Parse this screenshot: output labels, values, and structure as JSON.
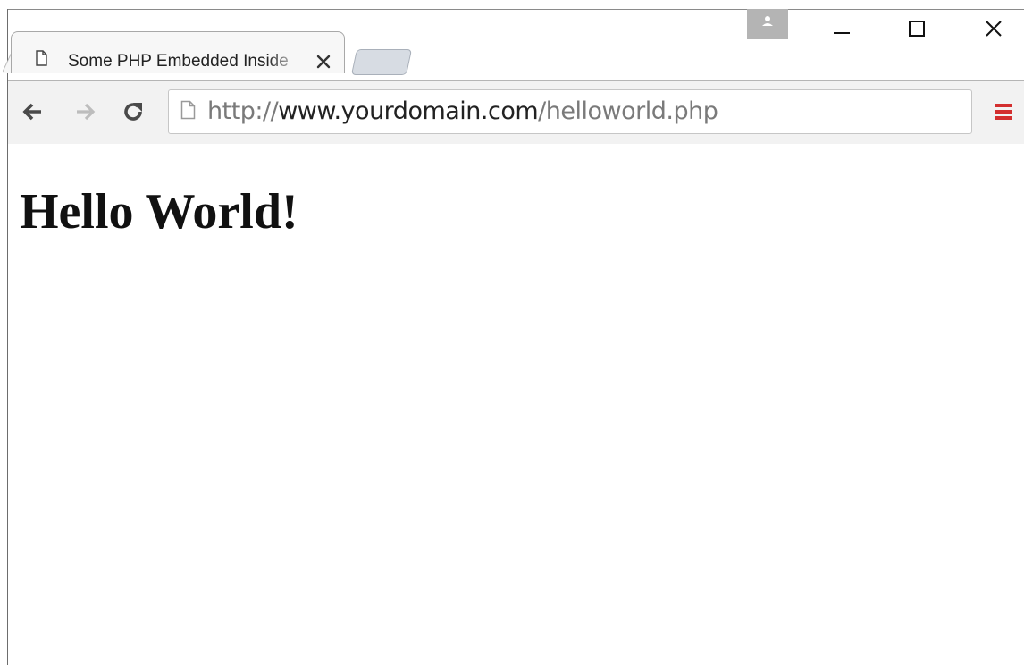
{
  "tab": {
    "title": "Some PHP Embedded Inside",
    "icon": "page-icon",
    "close_icon": "close-icon"
  },
  "window_controls": {
    "profile_icon": "person-icon",
    "minimize_icon": "minimize-icon",
    "maximize_icon": "maximize-icon",
    "close_icon": "close-icon"
  },
  "toolbar": {
    "back_icon": "back-arrow-icon",
    "forward_icon": "forward-arrow-icon",
    "reload_icon": "reload-icon",
    "page_icon": "page-icon",
    "menu_icon": "hamburger-menu-icon",
    "menu_color": "#d32f2f"
  },
  "address_bar": {
    "scheme": "http://",
    "host": "www.yourdomain.com",
    "path": "/helloworld.php"
  },
  "content": {
    "heading": "Hello World!"
  }
}
